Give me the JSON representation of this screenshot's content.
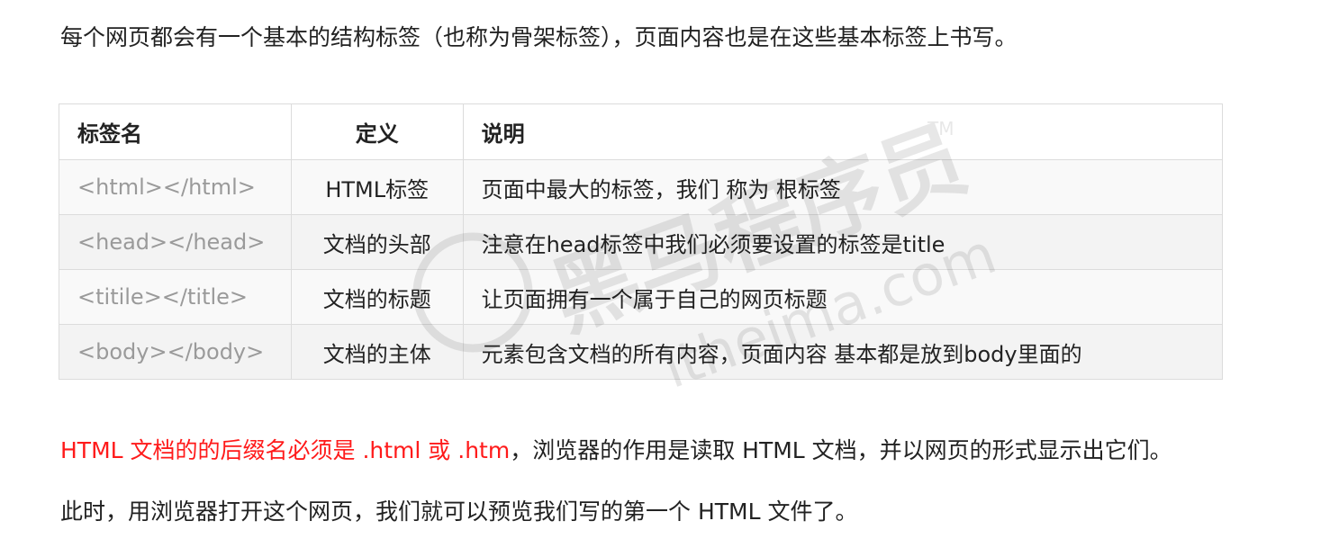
{
  "intro": "每个网页都会有一个基本的结构标签（也称为骨架标签），页面内容也是在这些基本标签上书写。",
  "table": {
    "headers": [
      "标签名",
      "定义",
      "说明"
    ],
    "rows": [
      {
        "tag": "<html></html>",
        "definition": "HTML标签",
        "description": "页面中最大的标签，我们 称为 根标签"
      },
      {
        "tag": "<head></head>",
        "definition": "文档的头部",
        "description": "注意在head标签中我们必须要设置的标签是title"
      },
      {
        "tag": "<titile></title>",
        "definition": "文档的标题",
        "description": "让页面拥有一个属于自己的网页标题"
      },
      {
        "tag": "<body></body>",
        "definition": "文档的主体",
        "description": "元素包含文档的所有内容，页面内容 基本都是放到body里面的"
      }
    ]
  },
  "extension_note": {
    "highlight": "HTML 文档的的后缀名必须是 .html 或 .htm",
    "rest": "，浏览器的作用是读取 HTML 文档，并以网页的形式显示出它们。"
  },
  "open_note": "此时，用浏览器打开这个网页，我们就可以预览我们写的第一个 HTML 文件了。",
  "watermark": {
    "brand": "黑马程序员",
    "tm": "TM",
    "url": "itheima.com"
  },
  "colors": {
    "highlight": "#ff1a1a",
    "tag_text": "#9a9a9a",
    "border": "#dcdcdc"
  }
}
